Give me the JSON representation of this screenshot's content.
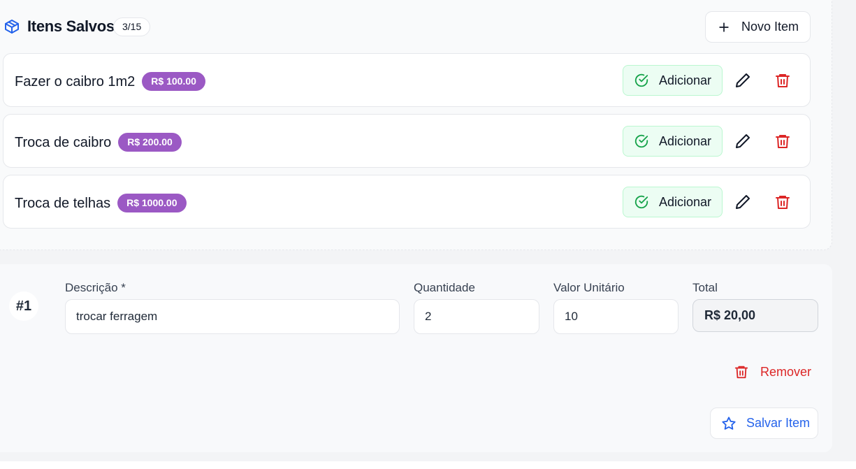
{
  "saved": {
    "title": "Itens Salvos",
    "count": "3/15",
    "new_label": "Novo Item",
    "add_label": "Adicionar",
    "items": [
      {
        "name": "Fazer o caibro 1m2",
        "price": "R$ 100.00"
      },
      {
        "name": "Troca de caibro",
        "price": "R$ 200.00"
      },
      {
        "name": "Troca de telhas",
        "price": "R$ 1000.00"
      }
    ]
  },
  "line": {
    "number": "#1",
    "description_label": "Descrição *",
    "description_value": "trocar ferragem",
    "quantity_label": "Quantidade",
    "quantity_value": "2",
    "unit_label": "Valor Unitário",
    "unit_value": "10",
    "total_label": "Total",
    "total_value": "R$ 20,00",
    "remove_label": "Remover",
    "save_label": "Salvar Item"
  },
  "icons": {
    "header": "box-icon",
    "new": "plus-icon",
    "add": "check-circle-icon",
    "edit": "pencil-icon",
    "delete": "trash-icon",
    "save": "star-icon"
  },
  "colors": {
    "accent": "#2563eb",
    "price_badge": "#9b59c4",
    "success": "#16a34a",
    "danger": "#dc2626"
  }
}
